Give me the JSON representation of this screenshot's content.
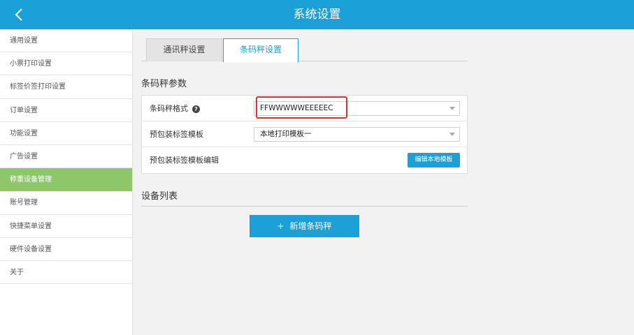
{
  "header": {
    "title": "系统设置",
    "back_icon": "chevron-left-icon"
  },
  "sidebar": {
    "items": [
      {
        "label": "通用设置",
        "active": false
      },
      {
        "label": "小票打印设置",
        "active": false
      },
      {
        "label": "标签价签打印设置",
        "active": false
      },
      {
        "label": "订单设置",
        "active": false
      },
      {
        "label": "功能设置",
        "active": false
      },
      {
        "label": "广告设置",
        "active": false
      },
      {
        "label": "称重设备管理",
        "active": true
      },
      {
        "label": "账号管理",
        "active": false
      },
      {
        "label": "快捷菜单设置",
        "active": false
      },
      {
        "label": "硬件设备设置",
        "active": false
      },
      {
        "label": "关于",
        "active": false
      }
    ]
  },
  "tabs": [
    {
      "label": "通讯秤设置",
      "active": false
    },
    {
      "label": "条码秤设置",
      "active": true
    }
  ],
  "params": {
    "section_title": "条码秤参数",
    "barcode_format_label": "条码秤格式",
    "barcode_format_value": "FFWWWWWEEEEEC",
    "template_label": "预包装标签模板",
    "template_value": "本地打印模板一",
    "template_edit_label": "预包装标签模板编辑",
    "edit_button": "编辑本地模板"
  },
  "devices": {
    "section_title": "设备列表",
    "add_button": "新增条码秤",
    "add_icon": "+"
  },
  "colors": {
    "primary": "#1ba0d8",
    "active_sidebar": "#8cc86a",
    "highlight": "#e03030"
  }
}
